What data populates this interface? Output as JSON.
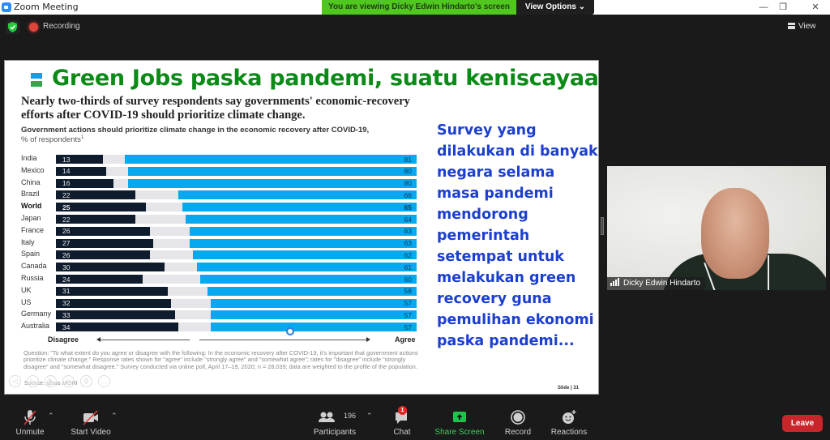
{
  "window": {
    "title": "Zoom Meeting",
    "viewing_banner": "You are viewing Dicky Edwin Hindarto's screen",
    "view_options_label": "View Options",
    "minimize_icon": "minimize-icon",
    "maximize_icon": "restore-icon",
    "close_icon": "close-icon"
  },
  "topbar": {
    "security_icon": "shield-check-icon",
    "recording_label": "Recording",
    "view_label": "View"
  },
  "slide": {
    "title": "Green Jobs paska pandemi, suatu keniscayaan",
    "headline": "Nearly two-thirds of survey respondents say governments' economic-recovery efforts after COVID-19 should prioritize climate change.",
    "subtitle": "Government actions should prioritize climate change in the economic recovery after COVID-19,",
    "subtitle2": "% of respondents",
    "subtitle2_sup": "1",
    "side_text": "Survey yang dilakukan di banyak negara selama masa pandemi mendorong pemerintah setempat untuk melakukan green recovery guna pemulihan ekonomi paska pandemi...",
    "footnote": "Question: \"To what extent do you agree or disagree with the following: In the economic recovery after COVID-19, it's important that government actions prioritize climate change.\" Response rates shown for \"agree\" include \"strongly agree\" and \"somewhat agree\"; rates for \"disagree\" include \"strongly disagree\" and \"somewhat disagree.\" Survey conducted via online poll, April 17–19, 2020; n = 28,039; data are weighted to the profile of the population.",
    "source": "Source: Ipsos MORI",
    "slide_number": "Slide | 31",
    "colors": {
      "title": "#0a8a16",
      "disagree": "#0e1c2e",
      "neutral": "#e6e6ea",
      "agree": "#06a8f0",
      "side_text": "#1c3fcf"
    }
  },
  "chart_data": {
    "type": "bar",
    "orientation": "horizontal-stacked",
    "title": "Government actions should prioritize climate change in the economic recovery after COVID-19, % of respondents",
    "categories": [
      "India",
      "Mexico",
      "China",
      "Brazil",
      "World",
      "Japan",
      "France",
      "Italy",
      "Spain",
      "Canada",
      "Russia",
      "UK",
      "US",
      "Germany",
      "Australia"
    ],
    "highlight": "World",
    "series": [
      {
        "name": "Disagree",
        "values": [
          13,
          14,
          16,
          22,
          25,
          22,
          26,
          27,
          26,
          30,
          24,
          31,
          32,
          33,
          34
        ]
      },
      {
        "name": "Agree",
        "values": [
          81,
          80,
          80,
          66,
          65,
          64,
          63,
          63,
          62,
          61,
          60,
          58,
          57,
          57,
          57
        ]
      }
    ],
    "xlabel_left": "Disagree",
    "xlabel_right": "Agree",
    "xlim": [
      0,
      100
    ]
  },
  "video": {
    "participant_name": "Dicky Edwin Hindarto"
  },
  "toolbar": {
    "unmute_label": "Unmute",
    "start_video_label": "Start Video",
    "participants_label": "Participants",
    "participants_count": "196",
    "chat_label": "Chat",
    "chat_badge": "1",
    "share_screen_label": "Share Screen",
    "record_label": "Record",
    "reactions_label": "Reactions",
    "leave_label": "Leave"
  }
}
